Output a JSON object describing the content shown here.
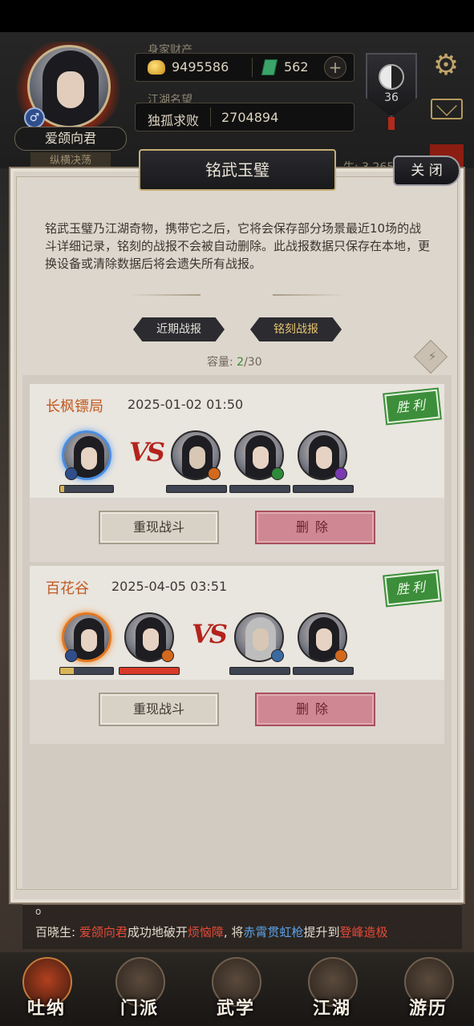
{
  "player": {
    "name": "爱颌向君",
    "sub_tag": "纵横决荡",
    "wealth_label": "身家财产",
    "coins": "9495586",
    "jade": "562",
    "add": "+",
    "fame_label": "江湖名望",
    "fame_title": "独孤求败",
    "fame_value": "2704894",
    "level": "36",
    "partial_stat": "生: 3,265"
  },
  "icons": {
    "gear": "gear-icon",
    "mail": "mail-icon",
    "taiji": "taiji-icon",
    "gender": "♂"
  },
  "modal": {
    "title": "铭武玉璧",
    "close_label": "关 闭",
    "description": "铭武玉璧乃江湖奇物，携带它之后，它将会保存部分场景最近10场的战斗详细记录，铭刻的战报不会被自动删除。此战报数据只保存在本地，更换设备或清除数据后将会遗失所有战报。",
    "tabs": [
      {
        "label": "近期战报",
        "active": false
      },
      {
        "label": "铭刻战报",
        "active": true
      }
    ],
    "capacity_label": "容量:",
    "capacity_current": "2",
    "capacity_max": "/30"
  },
  "reports": [
    {
      "opponent": "长枫镖局",
      "date": "2025-01-02 01:50",
      "result": "胜利",
      "allies_hp": [
        0.08
      ],
      "enemies_hp": [
        0,
        0,
        0
      ],
      "replay_label": "重现战斗",
      "delete_label": "删除"
    },
    {
      "opponent": "百花谷",
      "date": "2025-04-05 03:51",
      "result": "胜利",
      "allies_hp": [
        0.25,
        1.0
      ],
      "enemies_hp": [
        0,
        0
      ],
      "replay_label": "重现战斗",
      "delete_label": "删除"
    }
  ],
  "vs_text": "VS",
  "ticker": {
    "prefix": "百晓生: ",
    "name": "爱颌向君",
    "mid1": "成功地破开",
    "obstacle": "烦恼障",
    "mid2": ", 将",
    "skill": "赤霄贯虹枪",
    "mid3": "提升到",
    "realm": "登峰造极"
  },
  "nav": [
    {
      "label": "吐纳",
      "active": true
    },
    {
      "label": "门派",
      "active": false
    },
    {
      "label": "武学",
      "active": false
    },
    {
      "label": "江湖",
      "active": false
    },
    {
      "label": "游历",
      "active": false
    }
  ],
  "colors": {
    "accent_orange": "#c25a22",
    "win_green": "#3c8e3a",
    "delete_pink": "#cf8893",
    "capacity_green": "#3a8a2e"
  }
}
